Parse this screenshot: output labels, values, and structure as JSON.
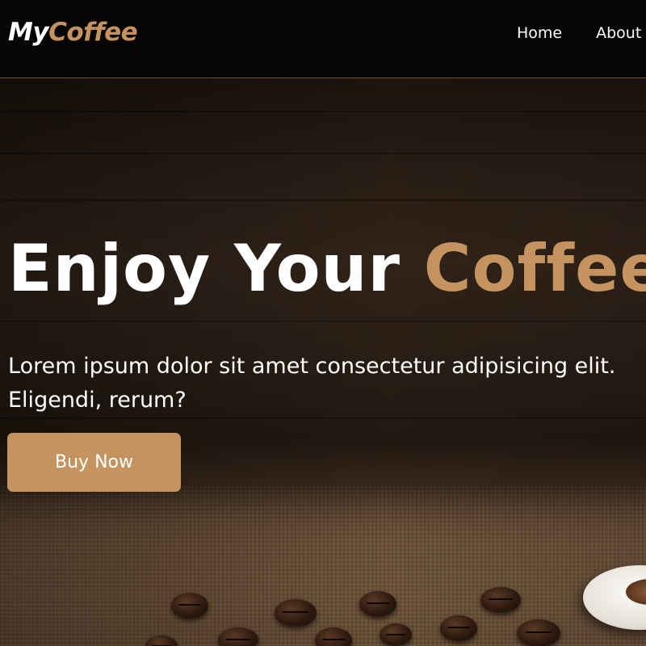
{
  "header": {
    "logo_part1": "My",
    "logo_part2": "Coffee",
    "nav": [
      {
        "label": "Home"
      },
      {
        "label": "About"
      }
    ]
  },
  "hero": {
    "title_part1": "Enjoy Your ",
    "title_part2": "Coffee",
    "text_line1": "Lorem ipsum dolor sit amet consectetur adipisicing elit.",
    "text_line2": "Eligendi, rerum?",
    "button_label": "Buy Now"
  },
  "colors": {
    "accent": "#c4935f",
    "header_bg": "#070504",
    "text": "#ffffff"
  }
}
